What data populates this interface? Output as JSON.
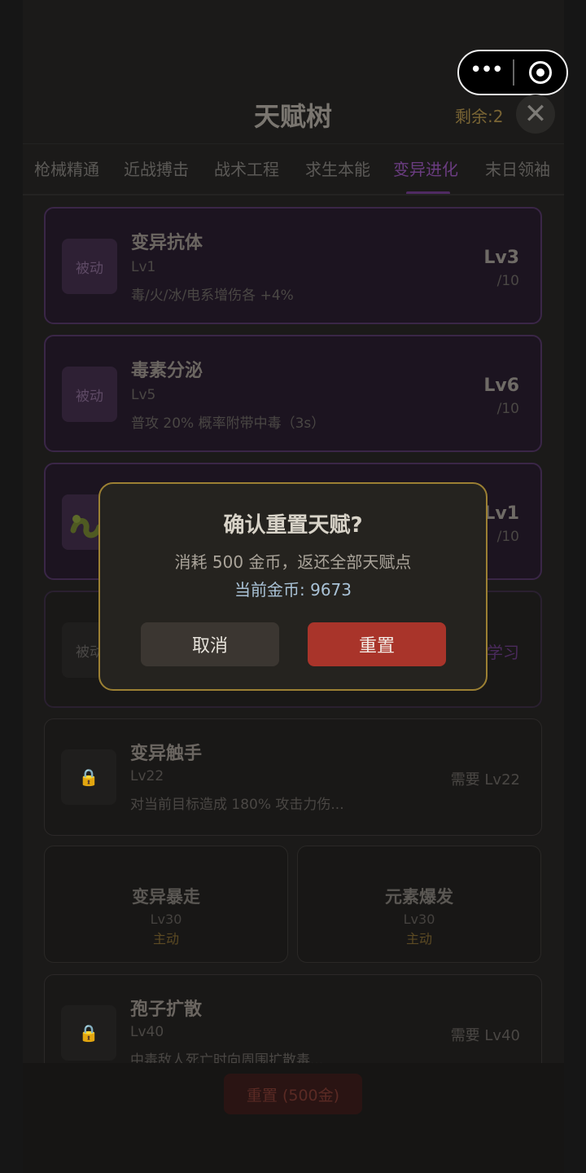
{
  "capsule": {
    "more_glyph": "•••",
    "record_icon": "target-icon"
  },
  "header": {
    "title": "天赋树",
    "remaining": "剩余:2",
    "close_glyph": "✕"
  },
  "tabs": [
    {
      "label": "枪械精通"
    },
    {
      "label": "近战搏击"
    },
    {
      "label": "战术工程"
    },
    {
      "label": "求生本能"
    },
    {
      "label": "变异进化",
      "active": true
    },
    {
      "label": "末日领袖"
    }
  ],
  "skills": [
    {
      "badge": "被动",
      "name": "变异抗体",
      "lv": "Lv1",
      "desc": "毒/火/冰/电系增伤各 +4%",
      "level": "Lv3",
      "max": "/10"
    },
    {
      "badge": "被动",
      "name": "毒素分泌",
      "lv": "Lv5",
      "desc": "普攻 20% 概率附带中毒（3s）",
      "level": "Lv6",
      "max": "/10"
    },
    {
      "badge": "",
      "name": "",
      "lv": "",
      "desc": "",
      "level": "Lv1",
      "max": "/10"
    },
    {
      "badge": "被动",
      "learn": "学习"
    },
    {
      "badge": "🔒",
      "name": "变异触手",
      "lv": "Lv22",
      "desc": "对当前目标造成 180% 攻击力伤...",
      "need": "需要 Lv22"
    },
    {
      "badge": "🔒",
      "name": "孢子扩散",
      "lv": "Lv40",
      "desc": "中毒敌人死亡时向周围扩散毒...",
      "need": "需要 Lv40"
    }
  ],
  "ultimates": [
    {
      "name": "变异暴走",
      "lv": "Lv30",
      "type": "主动"
    },
    {
      "name": "元素爆发",
      "lv": "Lv30",
      "type": "主动"
    }
  ],
  "footer": {
    "reset_label": "重置 (500金)"
  },
  "modal": {
    "title": "确认重置天赋?",
    "message": "消耗 500 金币，返还全部天赋点",
    "coins": "当前金币: 9673",
    "cancel": "取消",
    "confirm": "重置"
  },
  "colors": {
    "accent_purple": "#6a3c80",
    "gold_border": "#9c8033",
    "confirm_red": "#a9342a"
  }
}
